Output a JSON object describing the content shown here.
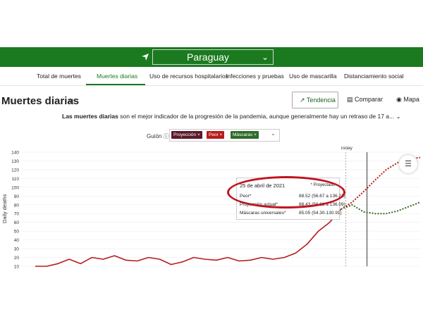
{
  "header": {
    "country": "Paraguay"
  },
  "tabs": [
    {
      "label": "Total de muertes"
    },
    {
      "label": "Muertes diarias",
      "active": true
    },
    {
      "label": "Uso de recursos hospitalarios"
    },
    {
      "label": "Infecciones y pruebas"
    },
    {
      "label": "Uso de mascarilla"
    },
    {
      "label": "Distanciamiento social"
    }
  ],
  "page": {
    "title": "Muertes diarias",
    "subtitle_bold": "Las muertes diarias",
    "subtitle_rest": " son el mejor indicador de la progresión de la pandemia, aunque generalmente hay un retraso de 17 a..."
  },
  "view_buttons": {
    "trend": "Tendencia",
    "compare": "Comparar",
    "map": "Mapa"
  },
  "guide": {
    "label": "Guión",
    "chips": [
      {
        "label": "Proyección ×",
        "color": "#5a1a2a"
      },
      {
        "label": "Peor ×",
        "color": "#b71c1c"
      },
      {
        "label": "Máscaras ×",
        "color": "#2e6b2a"
      }
    ]
  },
  "chart_data": {
    "type": "line",
    "ylabel": "Daily deaths",
    "ylim": [
      10,
      140
    ],
    "yticks": [
      10,
      20,
      30,
      40,
      50,
      60,
      70,
      80,
      90,
      100,
      110,
      120,
      130,
      140
    ],
    "today_label": "Today",
    "series": [
      {
        "name": "Proyección",
        "color": "#b71c1c",
        "style": "solid",
        "values": [
          10,
          10,
          13,
          18,
          13,
          20,
          18,
          22,
          17,
          16,
          20,
          18,
          12,
          15,
          20,
          18,
          17,
          20,
          16,
          17,
          20,
          18,
          20,
          25,
          35,
          50,
          60,
          75
        ]
      },
      {
        "name": "Peor",
        "color": "#b71c1c",
        "style": "dotted",
        "values": [
          75,
          83,
          95,
          108,
          120,
          128,
          132,
          134
        ]
      },
      {
        "name": "Máscaras",
        "color": "#33691e",
        "style": "dotted",
        "values": [
          75,
          80,
          72,
          70,
          70,
          73,
          78,
          83
        ]
      }
    ],
    "colors": {
      "line": "#b71c1c",
      "masks": "#33691e",
      "today": "#555555"
    }
  },
  "tooltip": {
    "date": "25 de abril de 2021",
    "projected": "* Proyectado",
    "rows": [
      {
        "label": "Peor*",
        "value": "88.52 (56.67 a 136.21)",
        "color": "#b71c1c"
      },
      {
        "label": "Proyección actual*",
        "value": "88.43 (56.61 a 136.09)",
        "color": "#5a1a2a"
      },
      {
        "label": "Máscaras universales*",
        "value": "85.05 (54.30-130.91)",
        "color": "#2e6b2a"
      }
    ]
  }
}
